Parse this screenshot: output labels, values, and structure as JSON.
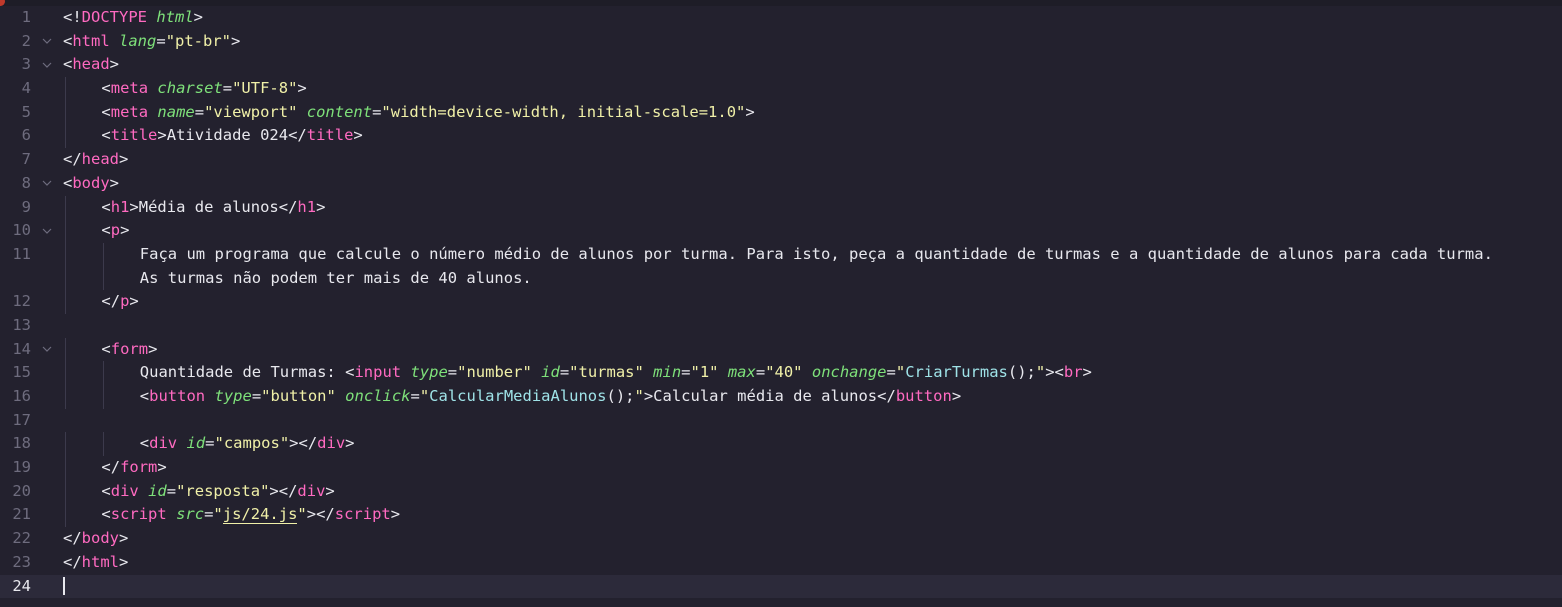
{
  "editor": {
    "language": "html",
    "current_line": 24
  },
  "lines": [
    {
      "num": "1",
      "fold": "",
      "indent": 0,
      "tokens": [
        [
          "t-punc",
          "<!"
        ],
        [
          "t-doc",
          "DOCTYPE"
        ],
        [
          "t-punc",
          " "
        ],
        [
          "t-attr",
          "html"
        ],
        [
          "t-punc",
          ">"
        ]
      ]
    },
    {
      "num": "2",
      "fold": "v",
      "indent": 0,
      "tokens": [
        [
          "t-punc",
          "<"
        ],
        [
          "t-tag",
          "html"
        ],
        [
          "t-punc",
          " "
        ],
        [
          "t-attr",
          "lang"
        ],
        [
          "t-punc",
          "="
        ],
        [
          "t-str",
          "\"pt-br\""
        ],
        [
          "t-punc",
          ">"
        ]
      ]
    },
    {
      "num": "3",
      "fold": "v",
      "indent": 0,
      "tokens": [
        [
          "t-punc",
          "<"
        ],
        [
          "t-tag",
          "head"
        ],
        [
          "t-punc",
          ">"
        ]
      ]
    },
    {
      "num": "4",
      "fold": "",
      "indent": 1,
      "tokens": [
        [
          "t-punc",
          "<"
        ],
        [
          "t-tag",
          "meta"
        ],
        [
          "t-punc",
          " "
        ],
        [
          "t-attr",
          "charset"
        ],
        [
          "t-punc",
          "="
        ],
        [
          "t-str",
          "\"UTF-8\""
        ],
        [
          "t-punc",
          ">"
        ]
      ]
    },
    {
      "num": "5",
      "fold": "",
      "indent": 1,
      "tokens": [
        [
          "t-punc",
          "<"
        ],
        [
          "t-tag",
          "meta"
        ],
        [
          "t-punc",
          " "
        ],
        [
          "t-attr",
          "name"
        ],
        [
          "t-punc",
          "="
        ],
        [
          "t-str",
          "\"viewport\""
        ],
        [
          "t-punc",
          " "
        ],
        [
          "t-attr",
          "content"
        ],
        [
          "t-punc",
          "="
        ],
        [
          "t-str",
          "\"width=device-width, initial-scale=1.0\""
        ],
        [
          "t-punc",
          ">"
        ]
      ]
    },
    {
      "num": "6",
      "fold": "",
      "indent": 1,
      "tokens": [
        [
          "t-punc",
          "<"
        ],
        [
          "t-tag",
          "title"
        ],
        [
          "t-punc",
          ">"
        ],
        [
          "t-txt",
          "Atividade 024"
        ],
        [
          "t-punc",
          "</"
        ],
        [
          "t-tag",
          "title"
        ],
        [
          "t-punc",
          ">"
        ]
      ]
    },
    {
      "num": "7",
      "fold": "",
      "indent": 0,
      "tokens": [
        [
          "t-punc",
          "</"
        ],
        [
          "t-tag",
          "head"
        ],
        [
          "t-punc",
          ">"
        ]
      ]
    },
    {
      "num": "8",
      "fold": "v",
      "indent": 0,
      "tokens": [
        [
          "t-punc",
          "<"
        ],
        [
          "t-tag",
          "body"
        ],
        [
          "t-punc",
          ">"
        ]
      ]
    },
    {
      "num": "9",
      "fold": "",
      "indent": 1,
      "tokens": [
        [
          "t-punc",
          "<"
        ],
        [
          "t-tag",
          "h1"
        ],
        [
          "t-punc",
          ">"
        ],
        [
          "t-txt",
          "Média de alunos"
        ],
        [
          "t-punc",
          "</"
        ],
        [
          "t-tag",
          "h1"
        ],
        [
          "t-punc",
          ">"
        ]
      ]
    },
    {
      "num": "10",
      "fold": "v",
      "indent": 1,
      "tokens": [
        [
          "t-punc",
          "<"
        ],
        [
          "t-tag",
          "p"
        ],
        [
          "t-punc",
          ">"
        ]
      ]
    },
    {
      "num": "11",
      "fold": "",
      "indent": 2,
      "tokens": [
        [
          "t-txt",
          "Faça um programa que calcule o número médio de alunos por turma. Para isto, peça a quantidade de turmas e a quantidade de alunos para cada turma."
        ]
      ]
    },
    {
      "num": "",
      "fold": "",
      "indent": 2,
      "tokens": [
        [
          "t-txt",
          "As turmas não podem ter mais de 40 alunos."
        ]
      ]
    },
    {
      "num": "12",
      "fold": "",
      "indent": 1,
      "tokens": [
        [
          "t-punc",
          "</"
        ],
        [
          "t-tag",
          "p"
        ],
        [
          "t-punc",
          ">"
        ]
      ]
    },
    {
      "num": "13",
      "fold": "",
      "indent": 0,
      "tokens": []
    },
    {
      "num": "14",
      "fold": "v",
      "indent": 1,
      "tokens": [
        [
          "t-punc",
          "<"
        ],
        [
          "t-tag",
          "form"
        ],
        [
          "t-punc",
          ">"
        ]
      ]
    },
    {
      "num": "15",
      "fold": "",
      "indent": 2,
      "tokens": [
        [
          "t-txt",
          "Quantidade de Turmas: "
        ],
        [
          "t-punc",
          "<"
        ],
        [
          "t-tag",
          "input"
        ],
        [
          "t-punc",
          " "
        ],
        [
          "t-attr",
          "type"
        ],
        [
          "t-punc",
          "="
        ],
        [
          "t-str",
          "\"number\""
        ],
        [
          "t-punc",
          " "
        ],
        [
          "t-attr",
          "id"
        ],
        [
          "t-punc",
          "="
        ],
        [
          "t-str",
          "\"turmas\""
        ],
        [
          "t-punc",
          " "
        ],
        [
          "t-attr",
          "min"
        ],
        [
          "t-punc",
          "="
        ],
        [
          "t-str",
          "\"1\""
        ],
        [
          "t-punc",
          " "
        ],
        [
          "t-attr",
          "max"
        ],
        [
          "t-punc",
          "="
        ],
        [
          "t-str",
          "\"40\""
        ],
        [
          "t-punc",
          " "
        ],
        [
          "t-attr",
          "onchange"
        ],
        [
          "t-punc",
          "="
        ],
        [
          "t-str",
          "\""
        ],
        [
          "t-fn",
          "CriarTurmas"
        ],
        [
          "t-punc",
          "();"
        ],
        [
          "t-str",
          "\""
        ],
        [
          "t-punc",
          "><"
        ],
        [
          "t-tag",
          "br"
        ],
        [
          "t-punc",
          ">"
        ]
      ]
    },
    {
      "num": "16",
      "fold": "",
      "indent": 2,
      "tokens": [
        [
          "t-punc",
          "<"
        ],
        [
          "t-tag",
          "button"
        ],
        [
          "t-punc",
          " "
        ],
        [
          "t-attr",
          "type"
        ],
        [
          "t-punc",
          "="
        ],
        [
          "t-str",
          "\"button\""
        ],
        [
          "t-punc",
          " "
        ],
        [
          "t-attr",
          "onclick"
        ],
        [
          "t-punc",
          "="
        ],
        [
          "t-str",
          "\""
        ],
        [
          "t-fn",
          "CalcularMediaAlunos"
        ],
        [
          "t-punc",
          "();"
        ],
        [
          "t-str",
          "\""
        ],
        [
          "t-punc",
          ">"
        ],
        [
          "t-txt",
          "Calcular média de alunos"
        ],
        [
          "t-punc",
          "</"
        ],
        [
          "t-tag",
          "button"
        ],
        [
          "t-punc",
          ">"
        ]
      ]
    },
    {
      "num": "17",
      "fold": "",
      "indent": 0,
      "tokens": []
    },
    {
      "num": "18",
      "fold": "",
      "indent": 2,
      "tokens": [
        [
          "t-punc",
          "<"
        ],
        [
          "t-tag",
          "div"
        ],
        [
          "t-punc",
          " "
        ],
        [
          "t-attr",
          "id"
        ],
        [
          "t-punc",
          "="
        ],
        [
          "t-str",
          "\"campos\""
        ],
        [
          "t-punc",
          "></"
        ],
        [
          "t-tag",
          "div"
        ],
        [
          "t-punc",
          ">"
        ]
      ]
    },
    {
      "num": "19",
      "fold": "",
      "indent": 1,
      "tokens": [
        [
          "t-punc",
          "</"
        ],
        [
          "t-tag",
          "form"
        ],
        [
          "t-punc",
          ">"
        ]
      ]
    },
    {
      "num": "20",
      "fold": "",
      "indent": 1,
      "tokens": [
        [
          "t-punc",
          "<"
        ],
        [
          "t-tag",
          "div"
        ],
        [
          "t-punc",
          " "
        ],
        [
          "t-attr",
          "id"
        ],
        [
          "t-punc",
          "="
        ],
        [
          "t-str",
          "\"resposta\""
        ],
        [
          "t-punc",
          "></"
        ],
        [
          "t-tag",
          "div"
        ],
        [
          "t-punc",
          ">"
        ]
      ]
    },
    {
      "num": "21",
      "fold": "",
      "indent": 1,
      "tokens": [
        [
          "t-punc",
          "<"
        ],
        [
          "t-tag",
          "script"
        ],
        [
          "t-punc",
          " "
        ],
        [
          "t-attr",
          "src"
        ],
        [
          "t-punc",
          "="
        ],
        [
          "t-str",
          "\""
        ],
        [
          "t-str link",
          "js/24.js"
        ],
        [
          "t-str",
          "\""
        ],
        [
          "t-punc",
          "></"
        ],
        [
          "t-tag",
          "script"
        ],
        [
          "t-punc",
          ">"
        ]
      ]
    },
    {
      "num": "22",
      "fold": "",
      "indent": 0,
      "tokens": [
        [
          "t-punc",
          "</"
        ],
        [
          "t-tag",
          "body"
        ],
        [
          "t-punc",
          ">"
        ]
      ]
    },
    {
      "num": "23",
      "fold": "",
      "indent": 0,
      "tokens": [
        [
          "t-punc",
          "</"
        ],
        [
          "t-tag",
          "html"
        ],
        [
          "t-punc",
          ">"
        ]
      ]
    },
    {
      "num": "24",
      "fold": "",
      "indent": 0,
      "tokens": [],
      "current": true
    }
  ]
}
